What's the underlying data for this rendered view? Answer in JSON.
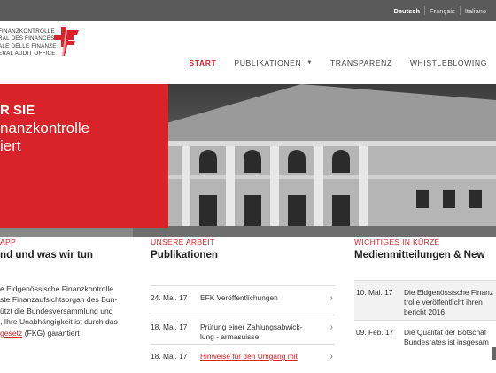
{
  "languages": [
    "Deutsch",
    "Français",
    "Italiano"
  ],
  "brand": [
    "Finanzkontrolle",
    "ral des finances",
    "ale delle finanze",
    "eral Audit Office"
  ],
  "nav": [
    {
      "label": "START",
      "active": true
    },
    {
      "label": "PUBLIKATIONEN",
      "has_dropdown": true
    },
    {
      "label": "TRANSPARENZ"
    },
    {
      "label": "WHISTLEBLOWING"
    }
  ],
  "hero": {
    "kicker": "R SIE",
    "line1": "nanzkontrolle",
    "line2": "iert"
  },
  "about": {
    "kicker": "APP",
    "title": "nd und was wir tun",
    "lines": [
      "e Eidgenössische Finanzkontrolle",
      "ste Finanzaufsichtsorgan des Bun-",
      "ützt die Bundesversammlung und",
      ", Ihre Unabhängigkeit ist durch das"
    ],
    "link": "gesetz",
    "after_link": " (FKG) garantiert"
  },
  "publications": {
    "kicker": "UNSERE ARBEIT",
    "title": "Publikationen",
    "items": [
      {
        "date": "24. Mai. 17",
        "text": "EFK Veröffentlichungen"
      },
      {
        "date": "18. Mai. 17",
        "text": "Prüfung einer Zahlungsabwick-\nlung - armasuisse"
      },
      {
        "date": "18. Mai. 17",
        "text": "Hinweise für den Umgang mit"
      }
    ]
  },
  "news": {
    "kicker": "WICHTIGES IN KÜRZE",
    "title": "Medienmitteilungen & New",
    "items": [
      {
        "date": "10. Mai. 17",
        "text": "Die Eidgenössische Finanz\ntrolle veröffentlicht ihren\nbericht 2016"
      },
      {
        "date": "09. Feb. 17",
        "text": "Die Qualität der Botschaf\nBundesrates ist insgesam"
      }
    ]
  },
  "colors": {
    "accent": "#d8232a",
    "topbar": "#5a5a5a"
  }
}
